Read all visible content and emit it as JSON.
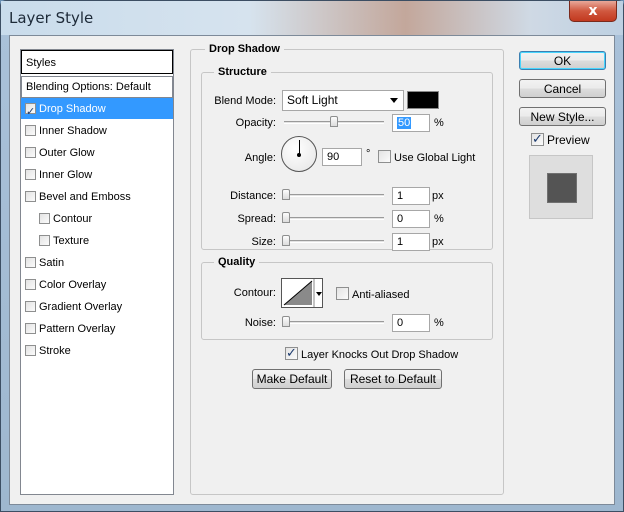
{
  "window": {
    "title": "Layer Style",
    "close_glyph": "x"
  },
  "styles_panel": {
    "header": "Styles",
    "blending_options": "Blending Options: Default",
    "items": [
      {
        "label": "Drop Shadow",
        "checked": true,
        "selected": true,
        "indent": false
      },
      {
        "label": "Inner Shadow",
        "checked": false,
        "selected": false,
        "indent": false
      },
      {
        "label": "Outer Glow",
        "checked": false,
        "selected": false,
        "indent": false
      },
      {
        "label": "Inner Glow",
        "checked": false,
        "selected": false,
        "indent": false
      },
      {
        "label": "Bevel and Emboss",
        "checked": false,
        "selected": false,
        "indent": false
      },
      {
        "label": "Contour",
        "checked": false,
        "selected": false,
        "indent": true
      },
      {
        "label": "Texture",
        "checked": false,
        "selected": false,
        "indent": true
      },
      {
        "label": "Satin",
        "checked": false,
        "selected": false,
        "indent": false
      },
      {
        "label": "Color Overlay",
        "checked": false,
        "selected": false,
        "indent": false
      },
      {
        "label": "Gradient Overlay",
        "checked": false,
        "selected": false,
        "indent": false
      },
      {
        "label": "Pattern Overlay",
        "checked": false,
        "selected": false,
        "indent": false
      },
      {
        "label": "Stroke",
        "checked": false,
        "selected": false,
        "indent": false
      }
    ]
  },
  "drop_shadow": {
    "group_title": "Drop Shadow",
    "structure": {
      "title": "Structure",
      "blend_mode_label": "Blend Mode:",
      "blend_mode_value": "Soft Light",
      "blend_color": "#000000",
      "opacity_label": "Opacity:",
      "opacity_value": "50",
      "opacity_unit": "%",
      "opacity_level": 0.5,
      "angle_label": "Angle:",
      "angle_value": "90",
      "angle_unit": "°",
      "use_global_light_label": "Use Global Light",
      "use_global_light_checked": false,
      "distance_label": "Distance:",
      "distance_value": "1",
      "distance_unit": "px",
      "spread_label": "Spread:",
      "spread_value": "0",
      "spread_unit": "%",
      "size_label": "Size:",
      "size_value": "1",
      "size_unit": "px"
    },
    "quality": {
      "title": "Quality",
      "contour_label": "Contour:",
      "anti_aliased_label": "Anti-aliased",
      "anti_aliased_checked": false,
      "noise_label": "Noise:",
      "noise_value": "0",
      "noise_unit": "%"
    },
    "layer_knocks_out_label": "Layer Knocks Out Drop Shadow",
    "layer_knocks_out_checked": true,
    "make_default_label": "Make Default",
    "reset_to_default_label": "Reset to Default"
  },
  "actions": {
    "ok_label": "OK",
    "cancel_label": "Cancel",
    "new_style_label": "New Style...",
    "preview_label": "Preview",
    "preview_checked": true
  },
  "colors": {
    "selection": "#3399ff",
    "preview_swatch": "#545454"
  }
}
